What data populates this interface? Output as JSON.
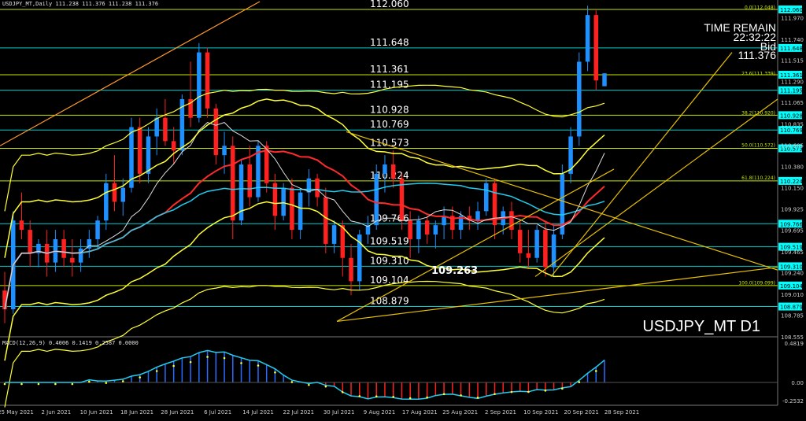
{
  "header": {
    "chart_title": "USDJPY_MT,Daily  111.238 111.376 111.238 111.376"
  },
  "time_remain": {
    "label": "TIME REMAIN",
    "time": "22:32:22",
    "bid_label": "Bid",
    "bid_value": "111.376"
  },
  "symbol_watermark": "USDJPY_MT D1",
  "macd": {
    "header": "MACD(12,26,9) 0.4006 0.1419 0.2587 0.0000",
    "scale_top": "0.4819",
    "scale_zero": "0.00",
    "scale_bottom": "-0.2532"
  },
  "center_marker": "109.263",
  "colors": {
    "background": "#000000",
    "bull_candle": "#1e90ff",
    "bear_candle": "#ff2020",
    "level_line": "#00cccc",
    "fib_line": "#c8e600",
    "bollinger": "#ffff33",
    "ma_red": "#ff2a2a",
    "ma_cyan": "#22ccee",
    "price_label_bg": "#00ffff"
  },
  "chart_data": {
    "type": "candlestick",
    "price_axis": {
      "min": 108.555,
      "max": 112.06,
      "ticks": [
        "111.970",
        "111.740",
        "111.515",
        "111.290",
        "111.065",
        "110.835",
        "110.605",
        "110.380",
        "110.150",
        "109.925",
        "109.695",
        "109.465",
        "109.240",
        "109.010",
        "108.785",
        "108.555"
      ]
    },
    "date_labels": [
      "25 May 2021",
      "2 Jun 2021",
      "10 Jun 2021",
      "18 Jun 2021",
      "28 Jun 2021",
      "6 Jul 2021",
      "14 Jul 2021",
      "22 Jul 2021",
      "30 Jul 2021",
      "9 Aug 2021",
      "17 Aug 2021",
      "25 Aug 2021",
      "2 Sep 2021",
      "10 Sep 2021",
      "20 Sep 2021",
      "28 Sep 2021"
    ],
    "horizontal_levels": [
      {
        "value": 112.06,
        "label": "112.060",
        "tag": "112.060"
      },
      {
        "value": 111.648,
        "label": "111.648",
        "tag": "111.648"
      },
      {
        "value": 111.361,
        "label": "111.361",
        "tag": "111.361"
      },
      {
        "value": 111.195,
        "label": "111.195",
        "tag": "111.195"
      },
      {
        "value": 110.928,
        "label": "110.928",
        "tag": "110.928"
      },
      {
        "value": 110.769,
        "label": "110.769",
        "tag": "110.769"
      },
      {
        "value": 110.573,
        "label": "110.573",
        "tag": "110.573"
      },
      {
        "value": 110.224,
        "label": "110.224",
        "tag": "110.224"
      },
      {
        "value": 109.766,
        "label": "109.766",
        "tag": "109.766"
      },
      {
        "value": 109.519,
        "label": "109.519",
        "tag": "109.519"
      },
      {
        "value": 109.31,
        "label": "109.310",
        "tag": "109.310"
      },
      {
        "value": 109.104,
        "label": "109.104",
        "tag": "109.104"
      },
      {
        "value": 108.879,
        "label": "108.879",
        "tag": "108.879"
      }
    ],
    "fib_labels": [
      {
        "value": 112.048,
        "text": "0.0(112.048)"
      },
      {
        "value": 111.339,
        "text": "23.6(111.339)"
      },
      {
        "value": 110.92,
        "text": "38.2(110.920)"
      },
      {
        "value": 110.572,
        "text": "50.0(110.572)"
      },
      {
        "value": 110.224,
        "text": "61.8(110.224)"
      },
      {
        "value": 109.099,
        "text": "100.0(109.099)"
      }
    ],
    "candles": [
      [
        109.05,
        109.25,
        108.7,
        108.85
      ],
      [
        108.85,
        109.9,
        108.8,
        109.8
      ],
      [
        109.8,
        110.1,
        109.6,
        109.7
      ],
      [
        109.7,
        109.8,
        109.3,
        109.45
      ],
      [
        109.45,
        109.6,
        109.3,
        109.55
      ],
      [
        109.55,
        109.7,
        109.2,
        109.35
      ],
      [
        109.35,
        109.7,
        109.25,
        109.6
      ],
      [
        109.6,
        109.7,
        109.3,
        109.4
      ],
      [
        109.4,
        109.6,
        109.2,
        109.35
      ],
      [
        109.35,
        109.6,
        109.25,
        109.5
      ],
      [
        109.5,
        109.7,
        109.4,
        109.6
      ],
      [
        109.6,
        109.85,
        109.5,
        109.8
      ],
      [
        109.8,
        110.3,
        109.7,
        110.2
      ],
      [
        110.2,
        110.5,
        109.9,
        110.0
      ],
      [
        110.0,
        110.25,
        109.85,
        110.15
      ],
      [
        110.15,
        110.9,
        110.1,
        110.8
      ],
      [
        110.8,
        110.9,
        110.2,
        110.3
      ],
      [
        110.3,
        110.8,
        110.2,
        110.7
      ],
      [
        110.7,
        111.0,
        110.5,
        110.9
      ],
      [
        110.9,
        111.1,
        110.6,
        110.65
      ],
      [
        110.65,
        110.8,
        110.4,
        110.55
      ],
      [
        110.55,
        111.15,
        110.5,
        111.1
      ],
      [
        111.1,
        111.5,
        110.8,
        110.9
      ],
      [
        110.9,
        111.7,
        110.85,
        111.6
      ],
      [
        111.6,
        111.65,
        110.9,
        111.0
      ],
      [
        111.0,
        111.05,
        110.4,
        110.5
      ],
      [
        110.5,
        110.75,
        110.3,
        110.6
      ],
      [
        110.6,
        110.7,
        109.6,
        109.8
      ],
      [
        109.8,
        110.45,
        109.75,
        110.4
      ],
      [
        110.4,
        110.6,
        109.95,
        110.05
      ],
      [
        110.05,
        110.65,
        110.0,
        110.6
      ],
      [
        110.6,
        110.65,
        110.1,
        110.2
      ],
      [
        110.2,
        110.3,
        109.7,
        109.85
      ],
      [
        109.85,
        110.2,
        109.8,
        110.15
      ],
      [
        110.15,
        110.25,
        109.6,
        109.7
      ],
      [
        109.7,
        110.15,
        109.6,
        110.1
      ],
      [
        110.1,
        110.35,
        109.95,
        110.25
      ],
      [
        110.25,
        110.3,
        109.95,
        110.05
      ],
      [
        110.05,
        110.15,
        109.45,
        109.55
      ],
      [
        109.55,
        109.8,
        109.45,
        109.75
      ],
      [
        109.75,
        109.8,
        109.2,
        109.4
      ],
      [
        109.4,
        109.55,
        109.0,
        109.15
      ],
      [
        109.15,
        109.7,
        109.05,
        109.65
      ],
      [
        109.65,
        109.85,
        109.55,
        109.75
      ],
      [
        109.75,
        110.4,
        109.7,
        110.3
      ],
      [
        110.3,
        110.5,
        110.1,
        110.4
      ],
      [
        110.4,
        110.55,
        110.15,
        110.25
      ],
      [
        110.25,
        110.3,
        109.7,
        109.8
      ],
      [
        109.8,
        109.9,
        109.4,
        109.6
      ],
      [
        109.6,
        109.85,
        109.45,
        109.8
      ],
      [
        109.8,
        109.85,
        109.55,
        109.65
      ],
      [
        109.65,
        109.8,
        109.5,
        109.75
      ],
      [
        109.75,
        109.95,
        109.6,
        109.85
      ],
      [
        109.85,
        109.95,
        109.6,
        109.7
      ],
      [
        109.7,
        109.9,
        109.6,
        109.85
      ],
      [
        109.85,
        109.95,
        109.7,
        109.8
      ],
      [
        109.8,
        110.0,
        109.7,
        109.9
      ],
      [
        109.9,
        110.25,
        109.85,
        110.2
      ],
      [
        110.2,
        110.25,
        109.6,
        109.75
      ],
      [
        109.75,
        109.95,
        109.65,
        109.9
      ],
      [
        109.9,
        110.0,
        109.6,
        109.7
      ],
      [
        109.7,
        109.8,
        109.35,
        109.45
      ],
      [
        109.45,
        109.7,
        109.3,
        109.4
      ],
      [
        109.4,
        109.75,
        109.35,
        109.7
      ],
      [
        109.7,
        109.8,
        109.2,
        109.3
      ],
      [
        109.3,
        109.75,
        109.2,
        109.65
      ],
      [
        109.65,
        110.4,
        109.6,
        110.3
      ],
      [
        110.3,
        110.8,
        110.2,
        110.7
      ],
      [
        110.7,
        111.6,
        110.6,
        111.5
      ],
      [
        111.5,
        112.1,
        111.4,
        112.0
      ],
      [
        112.0,
        112.05,
        111.2,
        111.3
      ],
      [
        111.238,
        111.376,
        111.238,
        111.376
      ]
    ]
  }
}
